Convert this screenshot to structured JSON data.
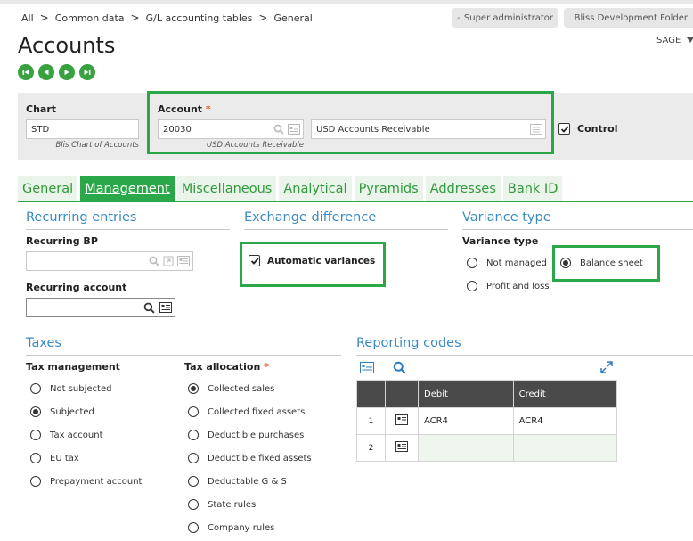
{
  "breadcrumb": [
    "All",
    "Common data",
    "G/L accounting tables",
    "General"
  ],
  "top_right": {
    "user": "Super administrator",
    "folder": "Bliss Development Folder",
    "sage": "SAGE"
  },
  "page_title": "Accounts",
  "header": {
    "chart_label": "Chart",
    "chart_value": "STD",
    "chart_desc": "Blis Chart of Accounts",
    "account_label": "Account",
    "account_value": "20030",
    "account_desc_sub": "USD Accounts Receivable",
    "account_name": "USD Accounts Receivable",
    "control_label": "Control"
  },
  "tabs": [
    "General",
    "Management",
    "Miscellaneous",
    "Analytical",
    "Pyramids",
    "Addresses",
    "Bank ID"
  ],
  "recurring": {
    "title": "Recurring entries",
    "bp_label": "Recurring BP",
    "account_label": "Recurring account"
  },
  "exchange": {
    "title": "Exchange difference",
    "auto_label": "Automatic variances"
  },
  "variance": {
    "title": "Variance type",
    "label": "Variance type",
    "options": [
      "Not managed",
      "Balance sheet",
      "Profit and loss"
    ]
  },
  "taxes": {
    "title": "Taxes",
    "mgmt_label": "Tax management",
    "mgmt_options": [
      "Not subjected",
      "Subjected",
      "Tax account",
      "EU tax",
      "Prepayment account"
    ],
    "alloc_label": "Tax allocation",
    "alloc_options": [
      "Collected sales",
      "Collected fixed assets",
      "Deductible purchases",
      "Deductible fixed assets",
      "Deductable G & S",
      "State rules",
      "Company rules"
    ]
  },
  "reporting": {
    "title": "Reporting codes",
    "columns": [
      "Debit",
      "Credit"
    ],
    "rows": [
      {
        "num": "1",
        "debit": "ACR4",
        "credit": "ACR4"
      },
      {
        "num": "2",
        "debit": "",
        "credit": ""
      }
    ]
  },
  "colors": {
    "accent_green": "#2aa748",
    "section_blue": "#3b8bc2",
    "required_star": "#e05a1c"
  }
}
